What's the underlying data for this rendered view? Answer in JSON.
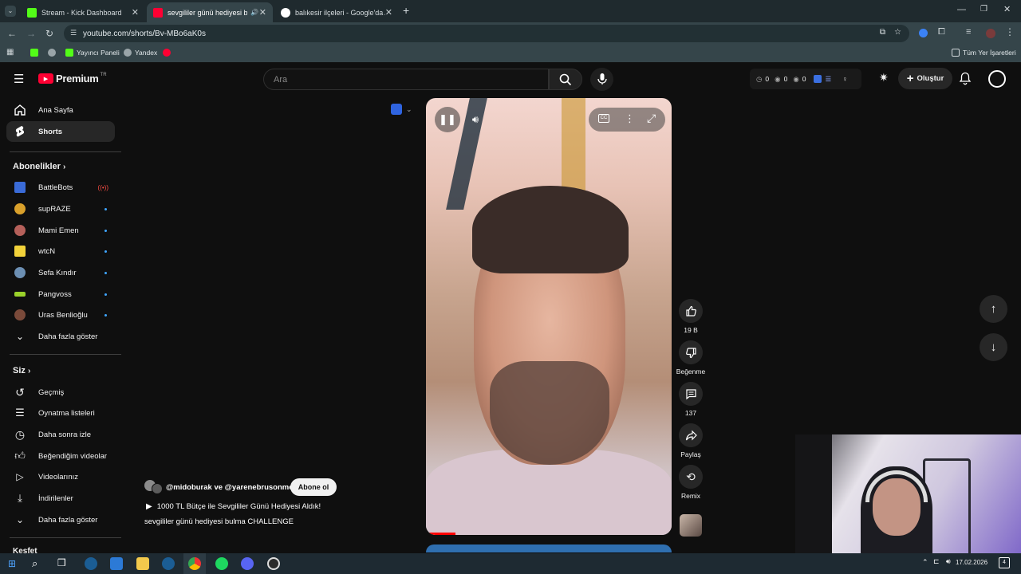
{
  "browser": {
    "tabs": [
      {
        "title": "Stream - Kick Dashboard",
        "favicon": "kick-icon",
        "color": "#53fc18"
      },
      {
        "title": "sevgililer günü hediyesi bul",
        "favicon": "youtube-icon",
        "color": "#ff0033"
      },
      {
        "title": "balıkesir ilçeleri - Google'da Ara",
        "favicon": "google-icon",
        "color": "#ffffff"
      }
    ],
    "url": "youtube.com/shorts/Bv-MBo6aK0s",
    "bookmarks": [
      {
        "label": ""
      },
      {
        "label": ""
      },
      {
        "label": "Yayıncı Paneli"
      },
      {
        "label": "Yandex"
      },
      {
        "label": ""
      }
    ],
    "all_bookmarks": "Tüm Yer İşaretleri"
  },
  "header": {
    "logo_text": "Premium",
    "logo_region": "TR",
    "search_placeholder": "Ara",
    "counters": [
      "0",
      "0",
      "0"
    ],
    "create_label": "Oluştur"
  },
  "sidebar": {
    "main": [
      {
        "label": "Ana Sayfa",
        "icon": "home-icon"
      },
      {
        "label": "Shorts",
        "icon": "shorts-icon",
        "active": true
      }
    ],
    "subscriptions_title": "Abonelikler",
    "subscriptions": [
      {
        "label": "BattleBots",
        "color": "#3a6bd8",
        "live": true
      },
      {
        "label": "supRAZE",
        "color": "#d9a02b"
      },
      {
        "label": "Mami Emen",
        "color": "#b5605a"
      },
      {
        "label": "wtcN",
        "color": "#f2d23a"
      },
      {
        "label": "Sefa Kındır",
        "color": "#6c8fb3"
      },
      {
        "label": "Pangvoss",
        "color": "#9ad12a"
      },
      {
        "label": "Uras Benlioğlu",
        "color": "#7a4a3a"
      }
    ],
    "show_more": "Daha fazla göster",
    "you_title": "Siz",
    "you": [
      {
        "label": "Geçmiş",
        "icon": "history-icon"
      },
      {
        "label": "Oynatma listeleri",
        "icon": "playlist-icon"
      },
      {
        "label": "Daha sonra izle",
        "icon": "clock-icon"
      },
      {
        "label": "Beğendiğim videolar",
        "icon": "like-icon"
      },
      {
        "label": "Videolarınız",
        "icon": "video-icon"
      },
      {
        "label": "İndirilenler",
        "icon": "download-icon"
      }
    ],
    "you_show_more": "Daha fazla göster",
    "explore_title": "Keşfet"
  },
  "short": {
    "channels": "@midoburak ve @yarenebrusonmez",
    "subscribe": "Abone ol",
    "title": "1000 TL Bütçe ile Sevgililer Günü Hediyesi Aldık!",
    "description": "sevgililer günü hediyesi bulma CHALLENGE",
    "progress": 0.12
  },
  "actions": {
    "likes": "19 B",
    "dislike": "Beğenme",
    "comments": "137",
    "share": "Paylaş",
    "remix": "Remix"
  },
  "taskbar": {
    "date": "17.02.2026"
  }
}
